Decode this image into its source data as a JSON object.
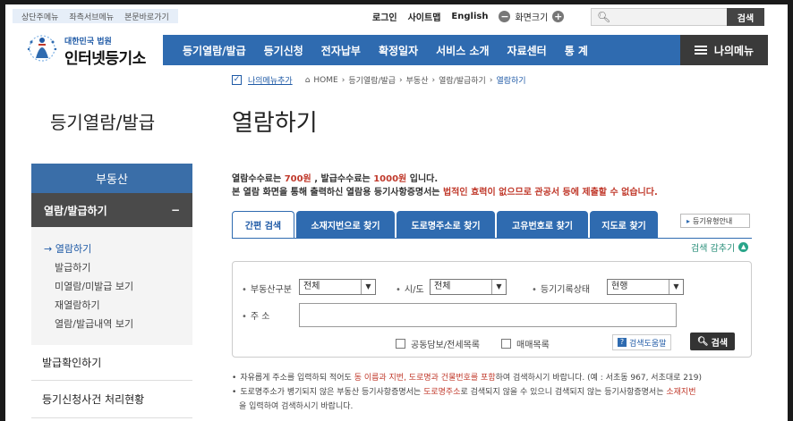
{
  "skip_links": [
    "상단주메뉴",
    "좌측서브메뉴",
    "본문바로가기"
  ],
  "util": {
    "login": "로그인",
    "sitemap": "사이트맵",
    "english": "English",
    "zoom_label": "화면크기",
    "zoom_minus": "−",
    "zoom_plus": "+",
    "search_button": "검색"
  },
  "logo": {
    "small": "대한민국 법원",
    "big": "인터넷등기소"
  },
  "gnb": {
    "items": [
      "등기열람/발급",
      "등기신청",
      "전자납부",
      "확정일자",
      "서비스 소개",
      "자료센터",
      "통 계"
    ],
    "my_menu": "나의메뉴"
  },
  "breadcrumb": {
    "add_my_menu": "나의메뉴추가",
    "home": "HOME",
    "path": [
      "등기열람/발급",
      "부동산",
      "열람/발급하기"
    ],
    "current": "열람하기"
  },
  "sidebar": {
    "title": "등기열람/발급",
    "category": "부동산",
    "selected": "열람/발급하기",
    "selected_toggle": "−",
    "sub_items": [
      "열람하기",
      "발급하기",
      "미열람/미발급 보기",
      "재열람하기",
      "열람/발급내역 보기"
    ],
    "links": [
      "발급확인하기",
      "등기신청사건 처리현황"
    ]
  },
  "content": {
    "title": "열람하기",
    "fee_line": {
      "a": "열람수수료는 ",
      "fee1": "700원",
      "b": " , 발급수수료는 ",
      "fee2": "1000원",
      "c": " 입니다."
    },
    "warn_line": {
      "a": "본 열람 화면을 통해 출력하신 열람용 등기사항증명서는 ",
      "b": "법적인 효력이 없으므로 관공서 등에 제출할 수 없습니다."
    },
    "tabs": [
      "간편 검색",
      "소재지번으로 찾기",
      "도로명주소로 찾기",
      "고유번호로 찾기",
      "지도로 찾기"
    ],
    "type_guide": "등기유형안내",
    "hide_search": "검색 감추기"
  },
  "form": {
    "type_label": "부동산구분",
    "type_value": "전체",
    "city_label": "시/도",
    "city_value": "전체",
    "status_label": "등기기록상태",
    "status_value": "현행",
    "addr_label": "주 소",
    "addr_value": "",
    "chk1": "공동담보/전세목록",
    "chk2": "매매목록",
    "help": "검색도움말",
    "search": "검색"
  },
  "notes": {
    "n1": {
      "a": "자유롭게 주소를 입력하되 적어도 ",
      "b": "동 이름과 지번, 도로명과 건물번호를 포함",
      "c": "하여 검색하시기 바랍니다. (예 : 서초동 967, 서초대로 219)"
    },
    "n2": {
      "a": "도로명주소가 병기되지 않은 부동산 등기사항증명서는 ",
      "b": "도로명주소",
      "c": "로 검색되지 않을 수 있으니 검색되지 않는 등기사항증명서는 ",
      "d": "소재지번"
    },
    "n3": "을 입력하여 검색하시기 바랍니다."
  }
}
